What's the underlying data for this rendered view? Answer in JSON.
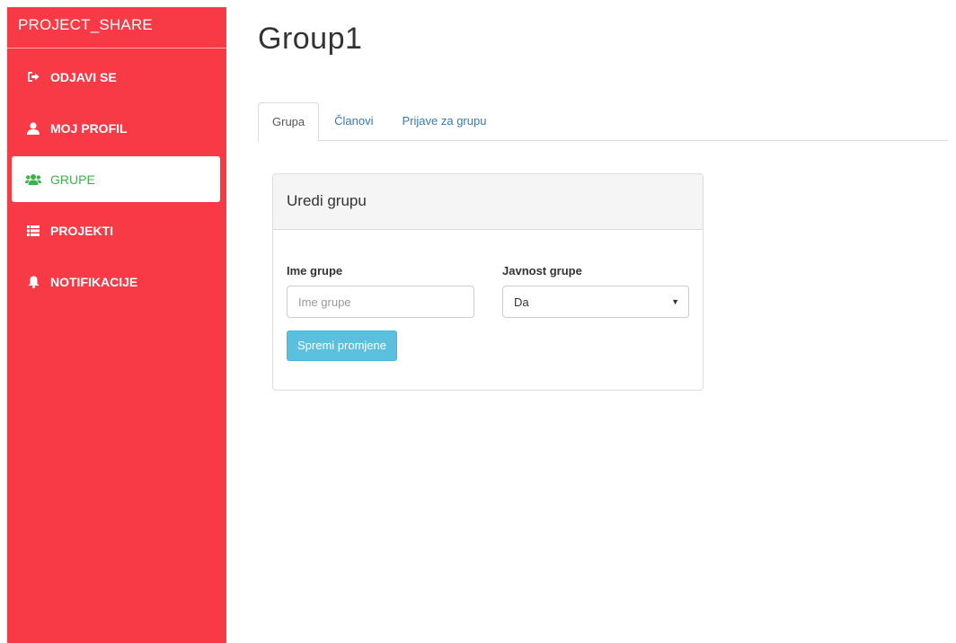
{
  "sidebar": {
    "brand": "PROJECT_SHARE",
    "items": [
      {
        "label": "ODJAVI SE",
        "icon": "logout-icon"
      },
      {
        "label": "MOJ PROFIL",
        "icon": "user-icon"
      },
      {
        "label": "GRUPE",
        "icon": "users-icon",
        "active": true
      },
      {
        "label": "PROJEKTI",
        "icon": "list-icon"
      },
      {
        "label": "NOTIFIKACIJE",
        "icon": "bell-icon"
      }
    ]
  },
  "main": {
    "title": "Group1",
    "tabs": [
      {
        "label": "Grupa",
        "active": true
      },
      {
        "label": "Članovi"
      },
      {
        "label": "Prijave za grupu"
      }
    ],
    "panel": {
      "heading": "Uredi grupu",
      "name_label": "Ime grupe",
      "name_value": "",
      "name_placeholder": "Ime grupe",
      "visibility_label": "Javnost grupe",
      "visibility_value": "Da",
      "save_label": "Spremi promjene"
    }
  },
  "colors": {
    "sidebar_bg": "#f73a45",
    "active_text": "#3cb34a",
    "link": "#337ab7",
    "button_info": "#5bc0de"
  }
}
